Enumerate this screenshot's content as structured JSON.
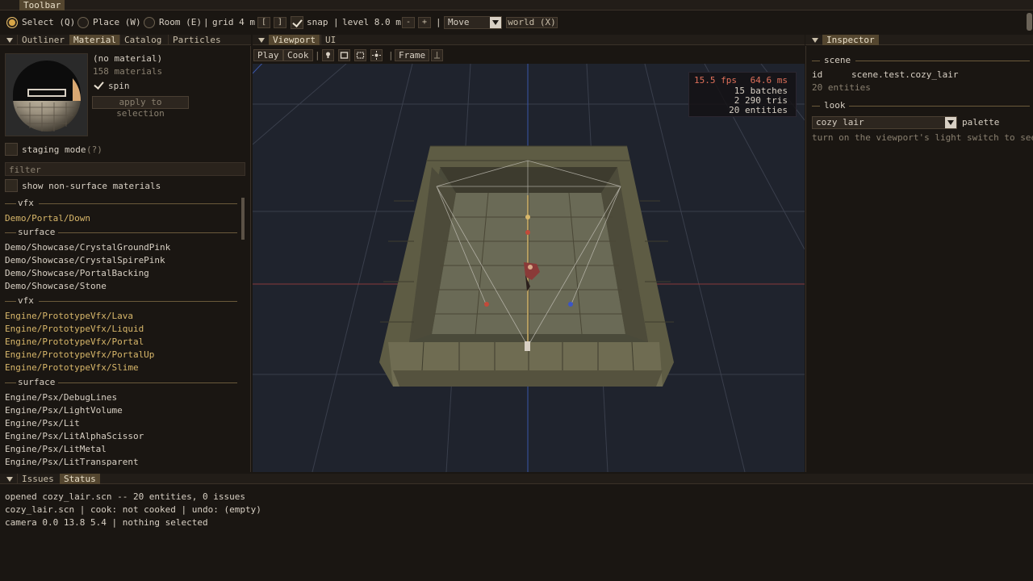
{
  "toolbar": {
    "title": "Toolbar",
    "select_label": "Select (Q)",
    "place_label": "Place (W)",
    "room_label": "Room (E)",
    "grid_label": "grid 4 m",
    "grid_dec": "[",
    "grid_inc": "]",
    "snap_label": "snap",
    "level_label": "level 8.0 m",
    "level_dec": "-",
    "level_inc": "+",
    "mode_value": "Move",
    "space_button": "world (X)"
  },
  "left_tabs": [
    "Outliner",
    "Material",
    "Catalog",
    "Particles"
  ],
  "material": {
    "name": "(no material)",
    "count": "158 materials",
    "spin_label": "spin",
    "apply_button": "apply to selection",
    "staging_label": "staging mode",
    "staging_hint": "(?)",
    "filter_placeholder": "filter",
    "show_nonsurface_label": "show non-surface materials",
    "groups": [
      {
        "header": "vfx",
        "items": [
          "Demo/Portal/Down"
        ]
      },
      {
        "header": "surface",
        "items": [
          "Demo/Showcase/CrystalGroundPink",
          "Demo/Showcase/CrystalSpirePink",
          "Demo/Showcase/PortalBacking",
          "Demo/Showcase/Stone"
        ]
      },
      {
        "header": "vfx",
        "items": [
          "Engine/PrototypeVfx/Lava",
          "Engine/PrototypeVfx/Liquid",
          "Engine/PrototypeVfx/Portal",
          "Engine/PrototypeVfx/PortalUp",
          "Engine/PrototypeVfx/Slime"
        ]
      },
      {
        "header": "surface",
        "items": [
          "Engine/Psx/DebugLines",
          "Engine/Psx/LightVolume",
          "Engine/Psx/Lit",
          "Engine/Psx/LitAlphaScissor",
          "Engine/Psx/LitMetal",
          "Engine/Psx/LitTransparent"
        ]
      }
    ]
  },
  "viewport": {
    "tabs": [
      "Viewport",
      "UI"
    ],
    "play_button": "Play",
    "cook_button": "Cook",
    "frame_button": "Frame",
    "stats": {
      "fps": "15.5 fps",
      "ms": "64.6 ms",
      "batches": "15 batches",
      "tris": "2 290 tris",
      "entities": "20 entities"
    }
  },
  "inspector": {
    "title": "Inspector",
    "scene_header": "scene",
    "id_label": "id",
    "id_value": "scene.test.cozy_lair",
    "entities": "20 entities",
    "look_header": "look",
    "palette_value": "cozy lair",
    "palette_label": "palette",
    "hint": "turn on the viewport's light switch to see i"
  },
  "bottom": {
    "tabs": [
      "Issues",
      "Status"
    ],
    "lines": [
      "opened cozy_lair.scn -- 20 entities, 0 issues",
      "cozy_lair.scn | cook: not cooked | undo: (empty)",
      "camera 0.0 13.8 5.4 | nothing selected"
    ]
  },
  "colors": {
    "accent": "#d8b76a",
    "background": "#1a1612",
    "viewport_bg": "#1f232d",
    "fps_warning": "#e0705a"
  }
}
